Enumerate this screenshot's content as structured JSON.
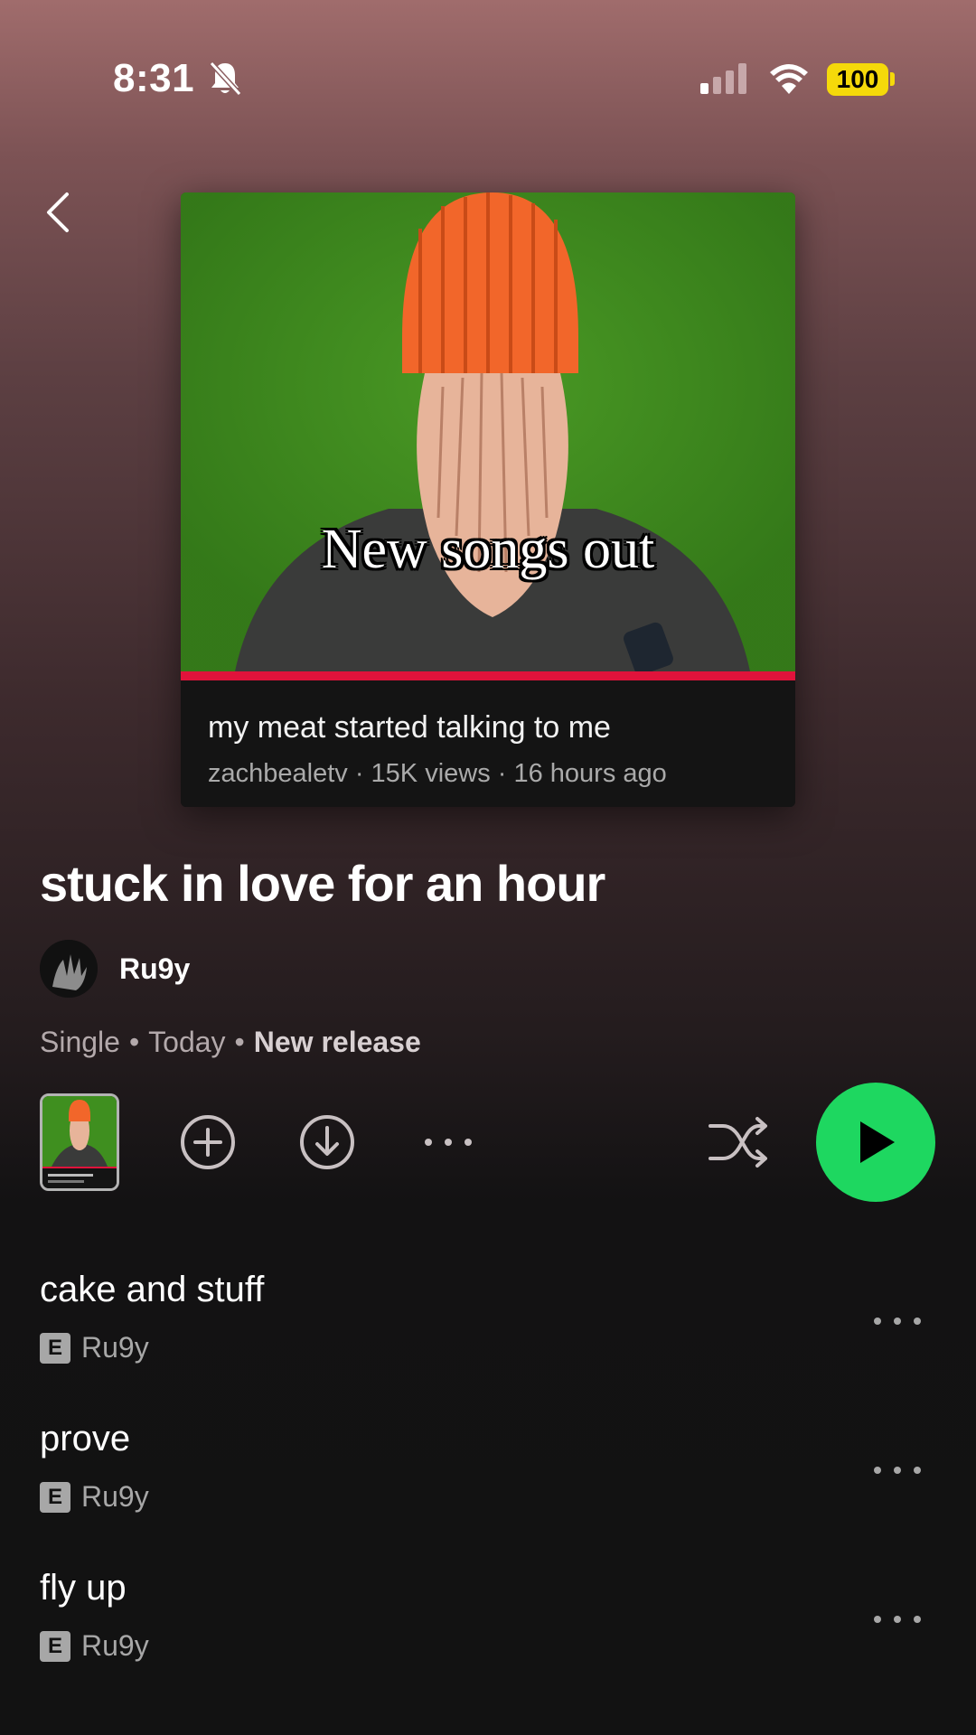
{
  "status_bar": {
    "time": "8:31",
    "battery": "100"
  },
  "album": {
    "cover": {
      "overlay_text": "New songs out",
      "video_title": "my meat started talking to me",
      "video_meta": "zachbealetv · 15K views · 16 hours ago"
    },
    "title": "stuck in love for an hour",
    "artist": "Ru9y",
    "meta": {
      "type": "Single",
      "date": "Today",
      "release_status": "New release"
    }
  },
  "controls": {
    "icons": [
      "add-icon",
      "download-icon",
      "more-icon",
      "shuffle-icon",
      "play-icon"
    ],
    "play_color": "#1ed760"
  },
  "tracks": [
    {
      "title": "cake and stuff",
      "explicit_badge": "E",
      "artist": "Ru9y"
    },
    {
      "title": "prove",
      "explicit_badge": "E",
      "artist": "Ru9y"
    },
    {
      "title": "fly up",
      "explicit_badge": "E",
      "artist": "Ru9y"
    }
  ]
}
